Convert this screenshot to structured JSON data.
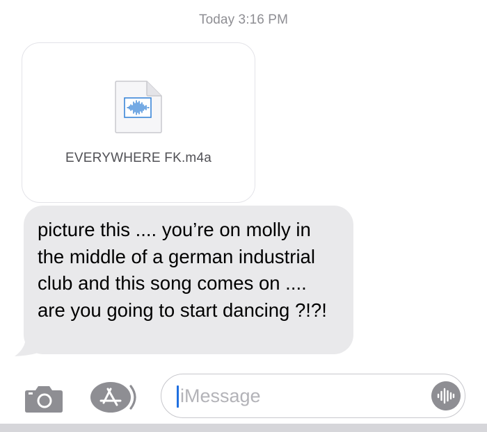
{
  "header": {
    "timestamp": "Today 3:16 PM"
  },
  "messages": {
    "attachment": {
      "file_name": "EVERYWHERE FK.m4a",
      "icon": "audio-file-icon"
    },
    "received_text": "picture this .... you’re on molly in the middle of a german industrial club and this song comes on .... are you going to start dancing ?!?!"
  },
  "composer": {
    "placeholder": "iMessage",
    "camera_icon": "camera-icon",
    "apps_icon": "app-store-icon",
    "audio_icon": "audio-waveform-icon"
  },
  "colors": {
    "received_bubble": "#e9e9eb",
    "timestamp_text": "#8e8e93",
    "caret": "#1f6fe0",
    "icon_gray": "#8e8e93",
    "waveform_blue": "#3a86d8"
  }
}
